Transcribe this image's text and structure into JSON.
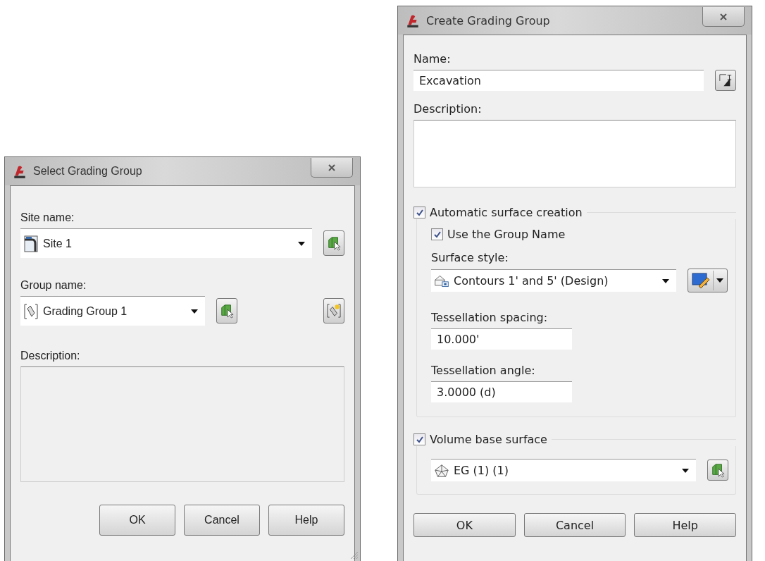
{
  "select_dialog": {
    "title": "Select Grading Group",
    "site_name": {
      "label": "Site name:",
      "value": "Site 1"
    },
    "group_name": {
      "label": "Group name:",
      "value": "Grading Group 1"
    },
    "description": {
      "label": "Description:",
      "disabled": true
    },
    "buttons": [
      "OK",
      "Cancel",
      "Help"
    ]
  },
  "create_dialog": {
    "title": "Create Grading Group",
    "name": {
      "label": "Name:",
      "value": "Excavation"
    },
    "description": {
      "label": "Description:",
      "disabled": false
    },
    "automatic_surface": {
      "label": "Automatic surface creation",
      "checked": true,
      "use_group_name": {
        "label": "Use the Group Name",
        "checked": true
      },
      "surface_style": {
        "label": "Surface style:",
        "value": "Contours 1' and 5' (Design)"
      },
      "tessellation_spacing": {
        "label": "Tessellation spacing:",
        "value": "10.000'"
      },
      "tessellation_angle": {
        "label": "Tessellation angle:",
        "value": "3.0000 (d)"
      }
    },
    "volume_base": {
      "label": "Volume base surface",
      "checked": true,
      "value": "EG (1) (1)"
    },
    "buttons": [
      "OK",
      "Cancel",
      "Help"
    ]
  }
}
